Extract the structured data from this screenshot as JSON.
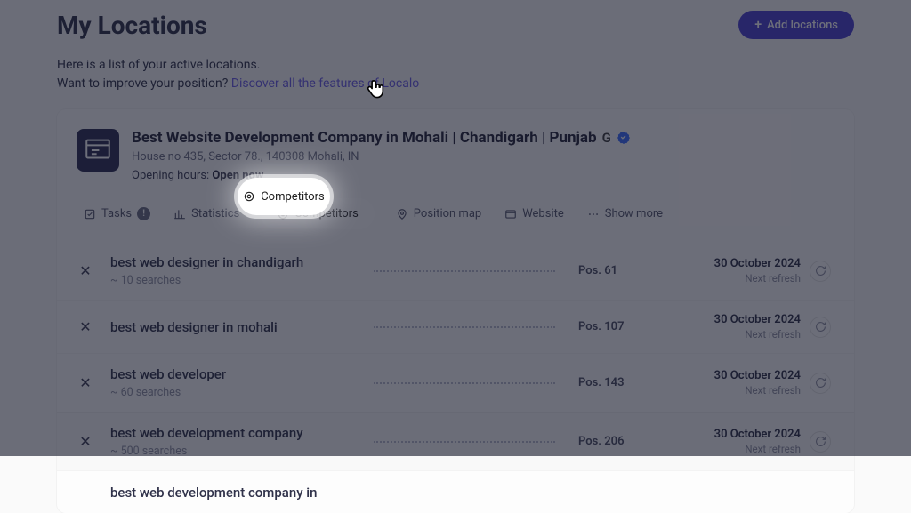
{
  "header": {
    "title": "My Locations",
    "add_button": "Add locations"
  },
  "subtext": {
    "line1": "Here is a list of your active locations.",
    "line2_prefix": "Want to improve your position? ",
    "line2_link": "Discover all the features of Localo"
  },
  "location": {
    "title": "Best Website Development Company in Mohali | Chandigarh | Punjab",
    "address": "House no 435, Sector 78., 140308 Mohali, IN",
    "hours_label": "Opening hours: ",
    "open_now": "Open now"
  },
  "tabs": {
    "tasks": "Tasks",
    "tasks_badge": "!",
    "statistics": "Statistics",
    "competitors": "Competitors",
    "position_map": "Position map",
    "website": "Website",
    "show_more": "Show more"
  },
  "keywords": [
    {
      "text": "best web designer in chandigarh",
      "sub": "~ 10 searches",
      "pos": "Pos. 61",
      "date": "30 October 2024",
      "refresh": "Next refresh"
    },
    {
      "text": "best web designer in mohali",
      "sub": "",
      "pos": "Pos. 107",
      "date": "30 October 2024",
      "refresh": "Next refresh"
    },
    {
      "text": "best web developer",
      "sub": "~ 60 searches",
      "pos": "Pos. 143",
      "date": "30 October 2024",
      "refresh": "Next refresh"
    },
    {
      "text": "best web development company",
      "sub": "~ 500 searches",
      "pos": "Pos. 206",
      "date": "30 October 2024",
      "refresh": "Next refresh"
    },
    {
      "text": "best web development company in",
      "sub": "",
      "pos": "",
      "date": "",
      "refresh": ""
    }
  ],
  "spotlight_label": "Competitors"
}
